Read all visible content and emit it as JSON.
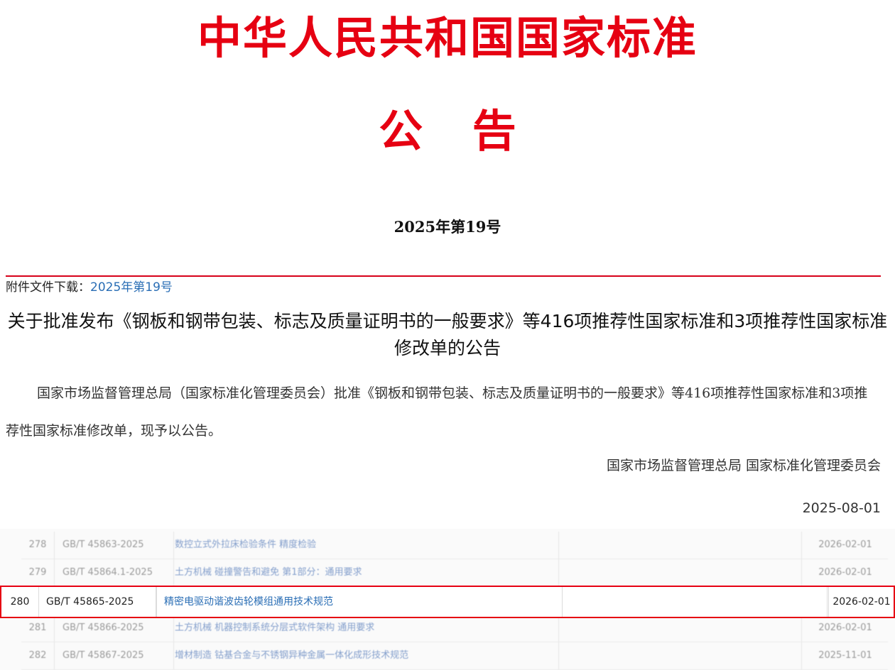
{
  "header": {
    "title": "中华人民共和国国家标准",
    "subtitle": "公 告",
    "issue_no": "2025年第19号"
  },
  "attachment": {
    "label": "附件文件下载：",
    "link_text": "2025年第19号"
  },
  "notice": {
    "title": "关于批准发布《钢板和钢带包装、标志及质量证明书的一般要求》等416项推荐性国家标准和3项推荐性国家标准修改单的公告",
    "body": "国家市场监督管理总局（国家标准化管理委员会）批准《钢板和钢带包装、标志及质量证明书的一般要求》等416项推荐性国家标准和3项推荐性国家标准修改单，现予以公告。",
    "signature_org": "国家市场监督管理总局 国家标准化管理委员会",
    "signature_date": "2025-08-01"
  },
  "table": {
    "rows": [
      {
        "num": "278",
        "code": "GB/T 45863-2025",
        "name": "数控立式外拉床检验条件 精度检验",
        "replace": "",
        "date": "2026-02-01"
      },
      {
        "num": "279",
        "code": "GB/T 45864.1-2025",
        "name": "土方机械 碰撞警告和避免 第1部分：通用要求",
        "replace": "",
        "date": "2026-02-01"
      },
      {
        "num": "281",
        "code": "GB/T 45866-2025",
        "name": "土方机械 机器控制系统分层式软件架构 通用要求",
        "replace": "",
        "date": "2026-02-01"
      },
      {
        "num": "282",
        "code": "GB/T 45867-2025",
        "name": "增材制造 钴基合金与不锈钢异种金属一体化成形技术规范",
        "replace": "",
        "date": "2025-11-01"
      }
    ],
    "highlighted": {
      "num": "280",
      "code": "GB/T 45865-2025",
      "name": "精密电驱动谐波齿轮模组通用技术规范",
      "replace": "",
      "date": "2026-02-01"
    }
  },
  "colors": {
    "header_red": "#e60012",
    "link_blue": "#2a6eb5",
    "highlight_border": "#e60012"
  }
}
